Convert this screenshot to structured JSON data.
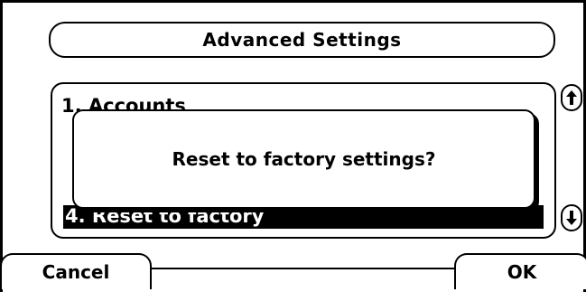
{
  "header": {
    "title": "Advanced Settings"
  },
  "list": {
    "items": [
      {
        "label": "1. Accounts"
      },
      {
        "label": "4. Reset to factory"
      }
    ],
    "selected_index": 1
  },
  "scroll": {
    "up_icon": "arrow-up-icon",
    "down_icon": "arrow-down-icon"
  },
  "dialog": {
    "message": "Reset to factory settings?"
  },
  "softkeys": {
    "left": "Cancel",
    "right": "OK"
  }
}
